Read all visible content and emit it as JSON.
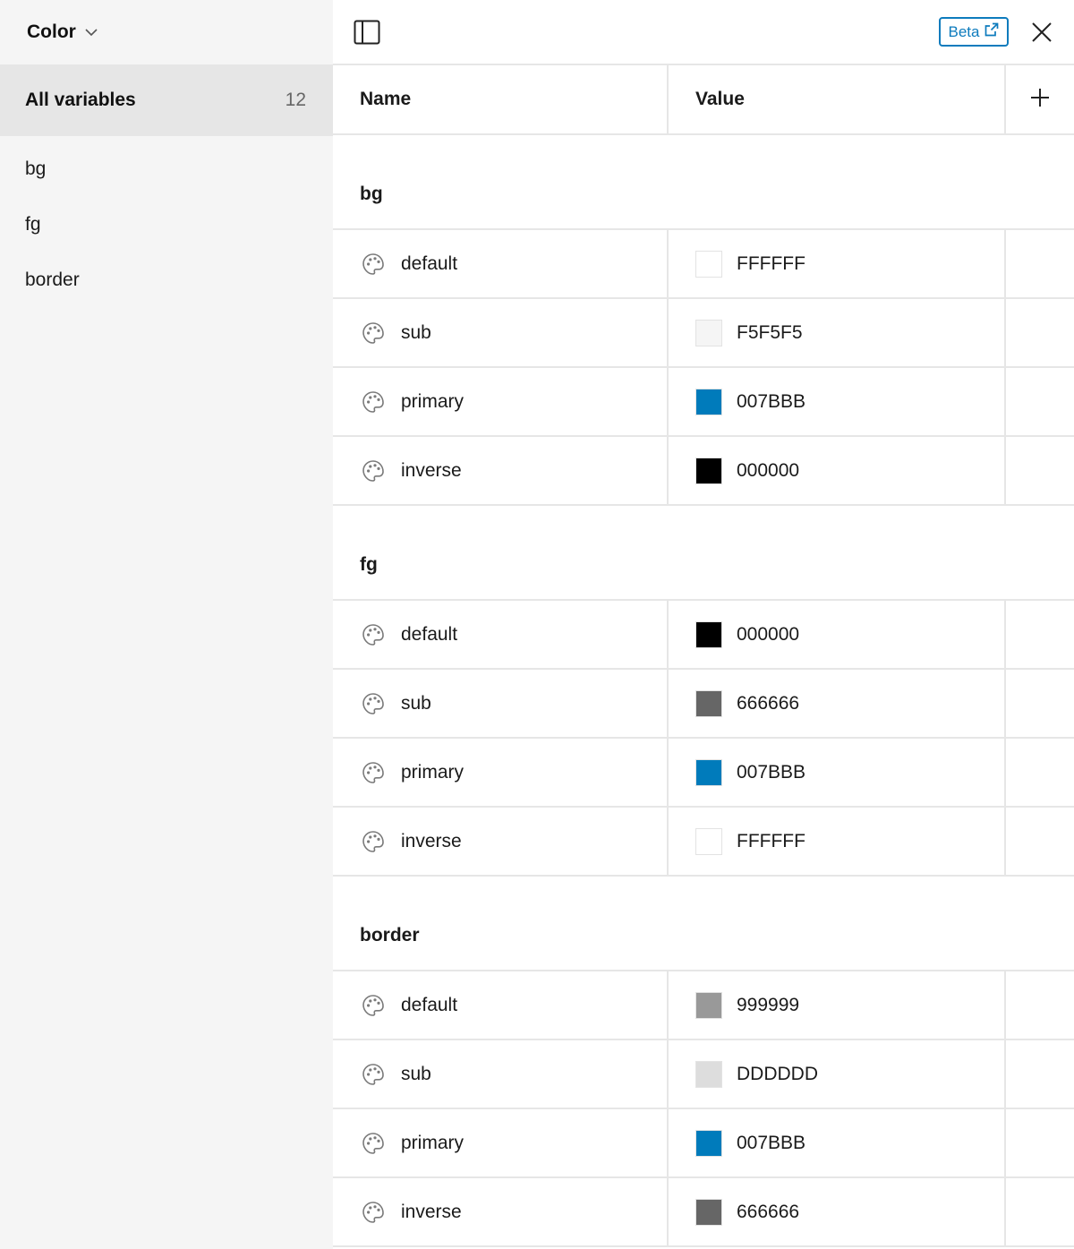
{
  "sidebar": {
    "collection": "Color",
    "all_variables": {
      "label": "All variables",
      "count": "12"
    },
    "groups": [
      "bg",
      "fg",
      "border"
    ]
  },
  "topbar": {
    "beta_label": "Beta"
  },
  "table": {
    "headers": {
      "name": "Name",
      "value": "Value"
    },
    "sections": [
      {
        "title": "bg",
        "rows": [
          {
            "name": "default",
            "value": "FFFFFF",
            "color": "#FFFFFF"
          },
          {
            "name": "sub",
            "value": "F5F5F5",
            "color": "#F5F5F5"
          },
          {
            "name": "primary",
            "value": "007BBB",
            "color": "#007BBB"
          },
          {
            "name": "inverse",
            "value": "000000",
            "color": "#000000"
          }
        ]
      },
      {
        "title": "fg",
        "rows": [
          {
            "name": "default",
            "value": "000000",
            "color": "#000000"
          },
          {
            "name": "sub",
            "value": "666666",
            "color": "#666666"
          },
          {
            "name": "primary",
            "value": "007BBB",
            "color": "#007BBB"
          },
          {
            "name": "inverse",
            "value": "FFFFFF",
            "color": "#FFFFFF"
          }
        ]
      },
      {
        "title": "border",
        "rows": [
          {
            "name": "default",
            "value": "999999",
            "color": "#999999"
          },
          {
            "name": "sub",
            "value": "DDDDDD",
            "color": "#DDDDDD"
          },
          {
            "name": "primary",
            "value": "007BBB",
            "color": "#007BBB"
          },
          {
            "name": "inverse",
            "value": "666666",
            "color": "#666666"
          }
        ]
      }
    ]
  }
}
